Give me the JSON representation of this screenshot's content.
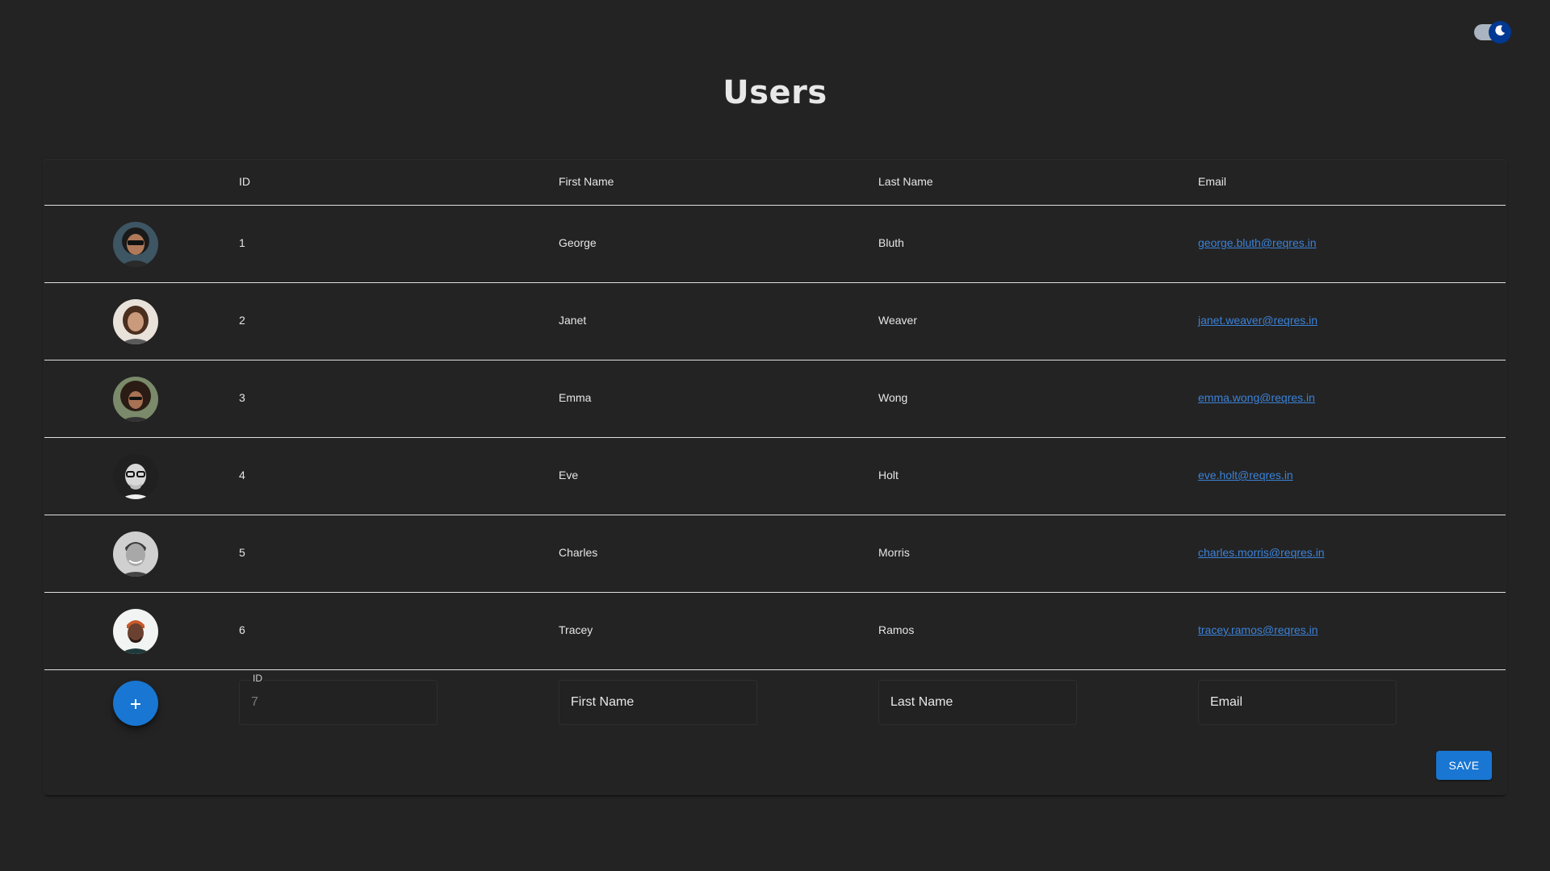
{
  "page": {
    "title": "Users",
    "theme_toggle": {
      "mode": "dark",
      "icon": "moon-icon"
    }
  },
  "table": {
    "columns": [
      "ID",
      "First Name",
      "Last Name",
      "Email"
    ],
    "rows": [
      {
        "id": "1",
        "first_name": "George",
        "last_name": "Bluth",
        "email": "george.bluth@reqres.in",
        "avatar": "avatar-george"
      },
      {
        "id": "2",
        "first_name": "Janet",
        "last_name": "Weaver",
        "email": "janet.weaver@reqres.in",
        "avatar": "avatar-janet"
      },
      {
        "id": "3",
        "first_name": "Emma",
        "last_name": "Wong",
        "email": "emma.wong@reqres.in",
        "avatar": "avatar-emma"
      },
      {
        "id": "4",
        "first_name": "Eve",
        "last_name": "Holt",
        "email": "eve.holt@reqres.in",
        "avatar": "avatar-eve"
      },
      {
        "id": "5",
        "first_name": "Charles",
        "last_name": "Morris",
        "email": "charles.morris@reqres.in",
        "avatar": "avatar-charles"
      },
      {
        "id": "6",
        "first_name": "Tracey",
        "last_name": "Ramos",
        "email": "tracey.ramos@reqres.in",
        "avatar": "avatar-tracey"
      }
    ]
  },
  "new_user_form": {
    "add_icon": "plus-icon",
    "id_label": "ID",
    "id_value": "7",
    "first_name_placeholder": "First Name",
    "last_name_placeholder": "Last Name",
    "email_placeholder": "Email",
    "save_label": "SAVE"
  },
  "colors": {
    "background": "#232323",
    "primary": "#1976d2",
    "link": "#3b82d8",
    "divider": "#e0e0e0"
  }
}
